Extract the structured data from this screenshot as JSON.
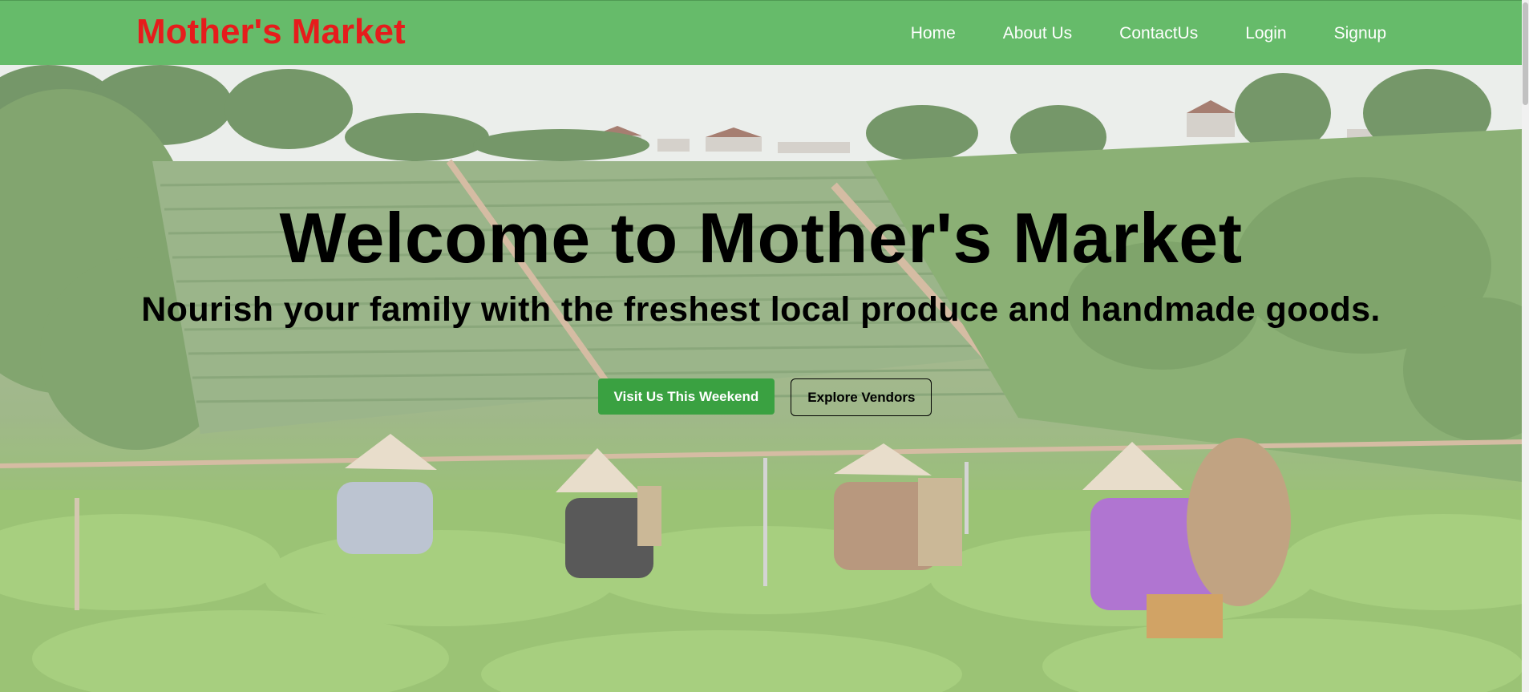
{
  "header": {
    "brand": "Mother's Market",
    "nav": [
      "Home",
      "About Us",
      "ContactUs",
      "Login",
      "Signup"
    ]
  },
  "hero": {
    "title": "Welcome to Mother's Market",
    "subtitle": "Nourish your family with the freshest local produce and handmade goods.",
    "primary_button": "Visit Us This Weekend",
    "secondary_button": "Explore Vendors",
    "background": "photo of women in conical hats harvesting tea leaves on a hillside plantation"
  },
  "colors": {
    "navbar": "#66bb6a",
    "brand": "#e61c1c",
    "primary_button": "#3aa141"
  }
}
